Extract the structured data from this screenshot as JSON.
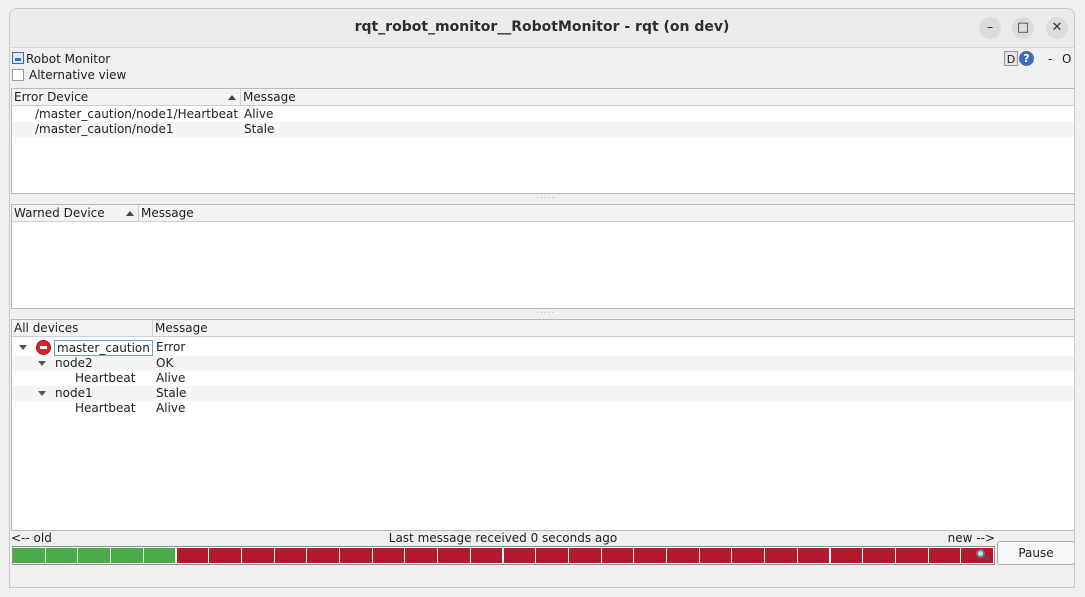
{
  "window": {
    "title": "rqt_robot_monitor__RobotMonitor - rqt (on dev)",
    "minimize_glyph": "–",
    "maximize_glyph": "□",
    "close_glyph": "✕"
  },
  "plugin": {
    "name": "Robot Monitor",
    "d_button": "D",
    "help_glyph": "?",
    "dash": "-",
    "o_label": "O"
  },
  "alternative_view": {
    "label": "Alternative view",
    "checked": false
  },
  "error_panel": {
    "columns": [
      "Error Device",
      "Message"
    ],
    "rows": [
      {
        "device": "/master_caution/node1/Heartbeat",
        "message": "Alive"
      },
      {
        "device": "/master_caution/node1",
        "message": "Stale"
      }
    ]
  },
  "warn_panel": {
    "columns": [
      "Warned Device",
      "Message"
    ],
    "rows": []
  },
  "all_panel": {
    "columns": [
      "All devices",
      "Message"
    ],
    "rows": [
      {
        "name": "master_caution",
        "message": "Error",
        "level": 0,
        "status_icon": "error-icon"
      },
      {
        "name": "node2",
        "message": "OK",
        "level": 1
      },
      {
        "name": "Heartbeat",
        "message": "Alive",
        "level": 2
      },
      {
        "name": "node1",
        "message": "Stale",
        "level": 1
      },
      {
        "name": "Heartbeat",
        "message": "Alive",
        "level": 2
      }
    ]
  },
  "timeline": {
    "old_label": "<-- old",
    "status_text": "Last message received 0 seconds ago",
    "new_label": "new -->",
    "segments": [
      "ok",
      "ok",
      "ok",
      "ok",
      "ok",
      "err",
      "err",
      "err",
      "err",
      "err",
      "err",
      "err",
      "err",
      "err",
      "err",
      "err",
      "err",
      "err",
      "err",
      "err",
      "err",
      "err",
      "err",
      "err",
      "err",
      "err",
      "err",
      "err",
      "err",
      "err"
    ],
    "colors": {
      "ok": "#4aab48",
      "err": "#b5172f"
    }
  },
  "pause_button": "Pause"
}
